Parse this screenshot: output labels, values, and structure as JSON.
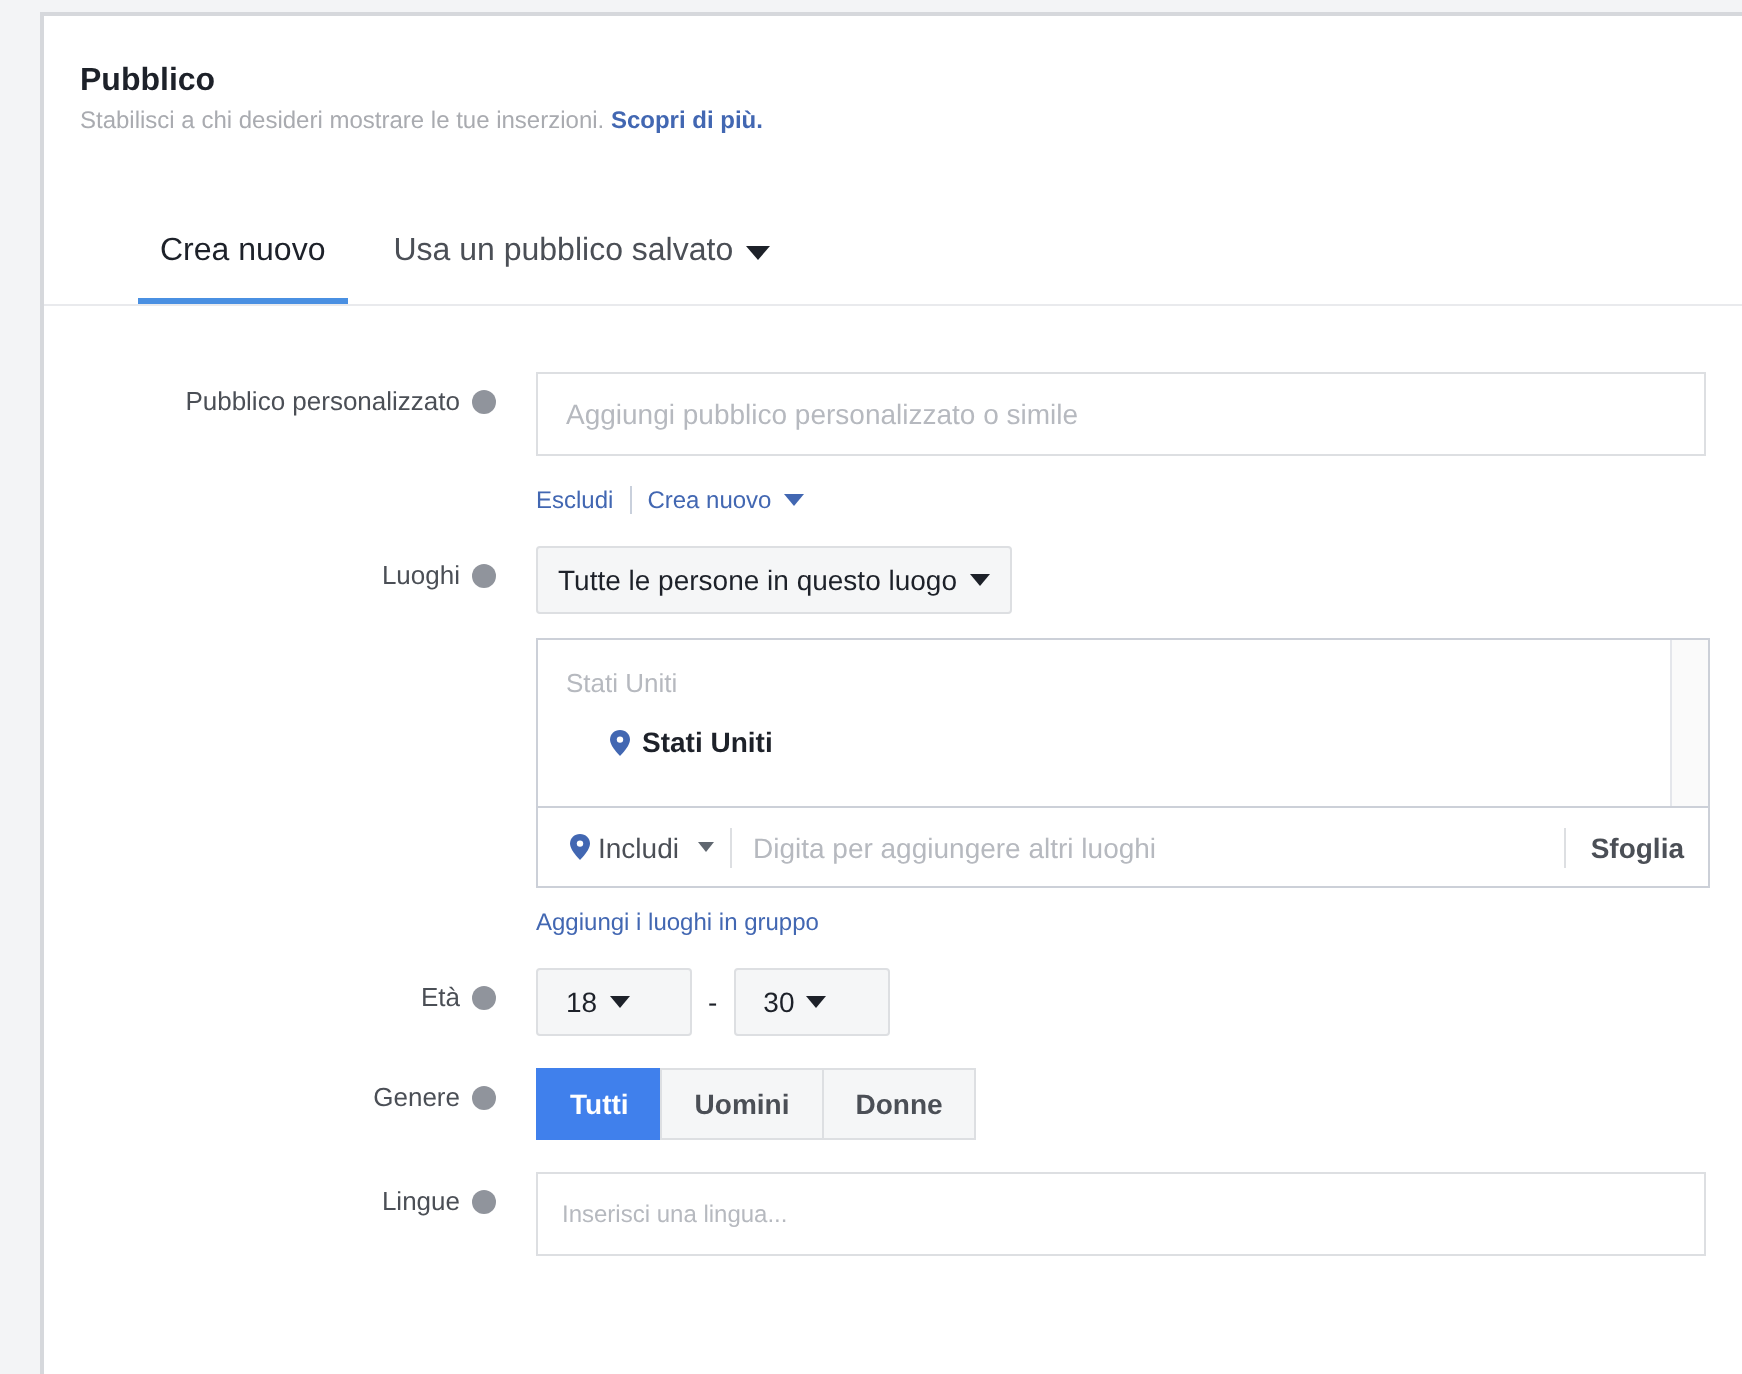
{
  "header": {
    "title": "Pubblico",
    "subtitle": "Stabilisci a chi desideri mostrare le tue inserzioni.",
    "link": "Scopri di più."
  },
  "tabs": [
    {
      "label": "Crea nuovo",
      "selected": true,
      "menu": false
    },
    {
      "label": "Usa un pubblico salvato",
      "selected": false,
      "menu": true
    }
  ],
  "custom_audience": {
    "label": "Pubblico personalizzato",
    "placeholder": "Aggiungi pubblico personalizzato o simile",
    "links": [
      {
        "label": "Escludi",
        "menu": false
      },
      {
        "label": "Crea nuovo",
        "menu": true
      }
    ]
  },
  "locations": {
    "label": "Luoghi",
    "mode": "Tutte le persone in questo luogo",
    "list_heading": "Stati Uniti",
    "places": [
      "Stati Uniti"
    ],
    "include": "Includi",
    "placeholder": "Digita per aggiungere altri luoghi",
    "browse": "Sfoglia",
    "group_link": "Aggiungi i luoghi in gruppo"
  },
  "age": {
    "label": "Età",
    "min": "18",
    "separator": "-",
    "max": "30"
  },
  "gender": {
    "label": "Genere",
    "options": [
      {
        "label": "Tutti",
        "selected": true
      },
      {
        "label": "Uomini",
        "selected": false
      },
      {
        "label": "Donne",
        "selected": false
      }
    ]
  },
  "languages": {
    "label": "Lingue",
    "placeholder": "Inserisci una lingua..."
  }
}
